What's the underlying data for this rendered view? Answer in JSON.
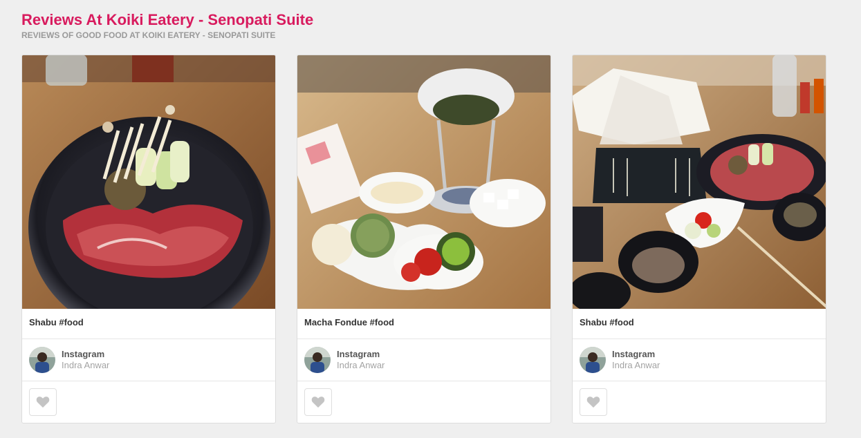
{
  "page": {
    "title": "Reviews At Koiki Eatery - Senopati Suite",
    "subtitle": "REVIEWS OF GOOD FOOD AT KOIKI EATERY - SENOPATI SUITE"
  },
  "colors": {
    "title": "#d81b5e",
    "subtitle": "#999999",
    "heart": "#c4c4c4"
  },
  "cards": [
    {
      "caption": "Shabu #food",
      "source": "Instagram",
      "user": "Indra Anwar",
      "like_icon": "heart-icon"
    },
    {
      "caption": "Macha Fondue #food",
      "source": "Instagram",
      "user": "Indra Anwar",
      "like_icon": "heart-icon"
    },
    {
      "caption": "Shabu #food",
      "source": "Instagram",
      "user": "Indra Anwar",
      "like_icon": "heart-icon"
    }
  ]
}
